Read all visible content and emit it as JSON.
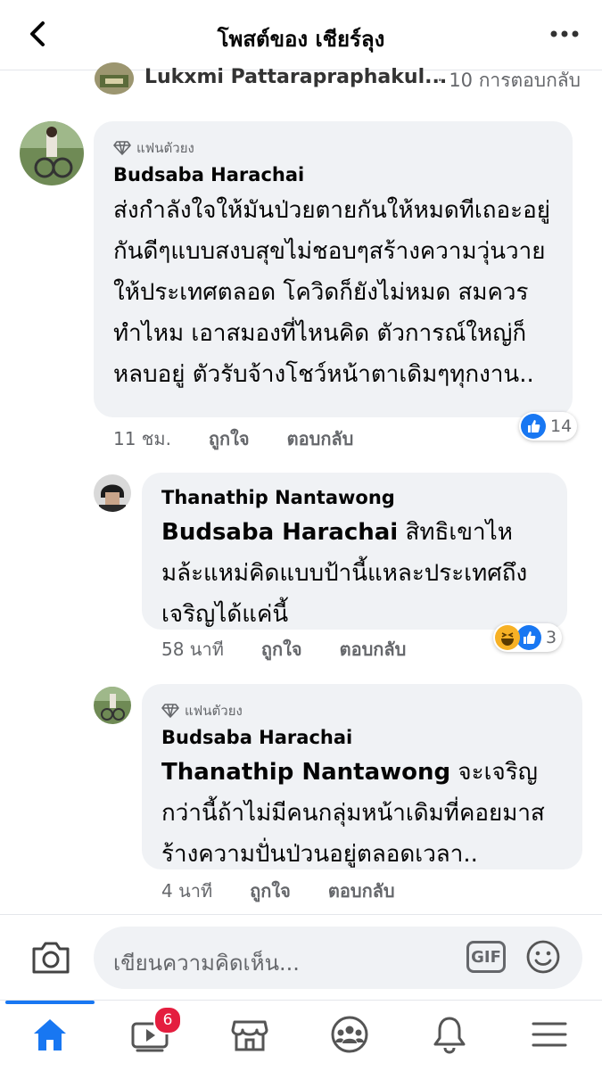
{
  "header": {
    "title": "โพสต์ของ เชียร์ลุง",
    "back_icon": "chevron-left-icon",
    "more_icon": "more-horizontal-icon"
  },
  "previous_comment": {
    "name": "Lukxmi Pattarapraphakul...",
    "replies": "· 10 การตอบกลับ"
  },
  "comments": [
    {
      "badge": "แฟนตัวยง",
      "author": "Budsaba Harachai",
      "text": "ส่งกำลังใจให้มันป่วยตายกันให้หมดทีเถอะอยู่กันดีๆแบบสงบสุขไม่ชอบๆสร้างความวุ่นวายให้ประเทศตลอด โควิดก็ยังไม่หมด สมควรทำไหม เอาสมองที่ไหนคิด ตัวการณ์ใหญ่ก็หลบอยู่ ตัวรับจ้างโชว์หน้าตาเดิมๆทุกงาน..",
      "time": "11 ชม.",
      "like_label": "ถูกใจ",
      "reply_label": "ตอบกลับ",
      "reaction_count": "14"
    },
    {
      "author": "Thanathip Nantawong",
      "mention": "Budsaba Harachai",
      "text": " สิทธิเขาไหมล้ะแหม่คิดแบบป้านี้แหละประเทศถึงเจริญได้แค่นี้",
      "time": "58 นาที",
      "like_label": "ถูกใจ",
      "reply_label": "ตอบกลับ",
      "reaction_count": "3"
    },
    {
      "badge": "แฟนตัวยง",
      "author": "Budsaba Harachai",
      "mention": "Thanathip Nantawong",
      "text": "  จะเจริญกว่านี้ถ้าไม่มีคนกลุ่มหน้าเดิมที่คอยมาสร้างความปั่นป่วนอยู่ตลอดเวลา..",
      "time": "4 นาที",
      "like_label": "ถูกใจ",
      "reply_label": "ตอบกลับ"
    }
  ],
  "composer": {
    "placeholder": "เขียนความคิดเห็น...",
    "gif_label": "GIF"
  },
  "tabbar": {
    "video_badge": "6",
    "items": [
      "home-icon",
      "video-icon",
      "marketplace-icon",
      "groups-icon",
      "notifications-icon",
      "menu-icon"
    ]
  },
  "colors": {
    "accent": "#1877f2",
    "bubble": "#f0f2f5",
    "badge": "#e41e3f",
    "meta": "#65676b"
  }
}
